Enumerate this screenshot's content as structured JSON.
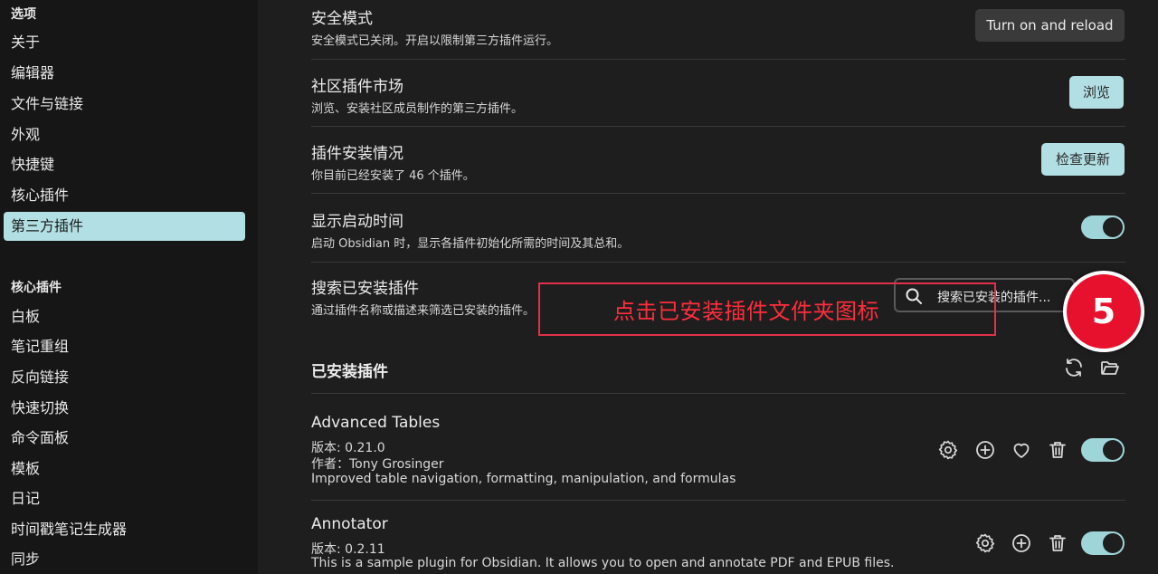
{
  "sidebar": {
    "options_heading": "选项",
    "options_items": [
      {
        "label": "关于"
      },
      {
        "label": "编辑器"
      },
      {
        "label": "文件与链接"
      },
      {
        "label": "外观"
      },
      {
        "label": "快捷键"
      },
      {
        "label": "核心插件"
      },
      {
        "label": "第三方插件",
        "active": true
      }
    ],
    "core_heading": "核心插件",
    "core_items": [
      {
        "label": "白板"
      },
      {
        "label": "笔记重组"
      },
      {
        "label": "反向链接"
      },
      {
        "label": "快速切换"
      },
      {
        "label": "命令面板"
      },
      {
        "label": "模板"
      },
      {
        "label": "日记"
      },
      {
        "label": "时间戳笔记生成器"
      },
      {
        "label": "同步"
      }
    ]
  },
  "settings": {
    "safe_mode": {
      "name": "安全模式",
      "desc": "安全模式已关闭。开启以限制第三方插件运行。",
      "button": "Turn on and reload"
    },
    "community": {
      "name": "社区插件市场",
      "desc": "浏览、安装社区成员制作的第三方插件。",
      "button": "浏览"
    },
    "installed_status": {
      "name": "插件安装情况",
      "desc": "你目前已经安装了 46 个插件。",
      "button": "检查更新"
    },
    "startup_time": {
      "name": "显示启动时间",
      "desc": "启动 Obsidian 时，显示各插件初始化所需的时间及其总和。",
      "enabled": true
    },
    "search": {
      "name": "搜索已安装插件",
      "desc": "通过插件名称或描述来筛选已安装的插件。",
      "placeholder": "搜索已安装的插件..."
    }
  },
  "installed": {
    "title": "已安装插件",
    "icons": [
      "reload-icon",
      "folder-open-icon"
    ],
    "plugins": [
      {
        "name": "Advanced Tables",
        "version": "版本: 0.21.0",
        "author": "作者：Tony Grosinger",
        "desc": "Improved table navigation, formatting, manipulation, and formulas",
        "enabled": true
      },
      {
        "name": "Annotator",
        "version": "版本: 0.2.11",
        "desc": "This is a sample plugin for Obsidian. It allows you to open and annotate PDF and EPUB files.",
        "enabled": true
      }
    ]
  },
  "annotation": {
    "text": "点击已安装插件文件夹图标",
    "step": "5"
  },
  "colors": {
    "accent": "#b2dfe3",
    "annotation_red": "#e8112d",
    "background": "#1e1e1e",
    "sidebar": "#161616"
  }
}
